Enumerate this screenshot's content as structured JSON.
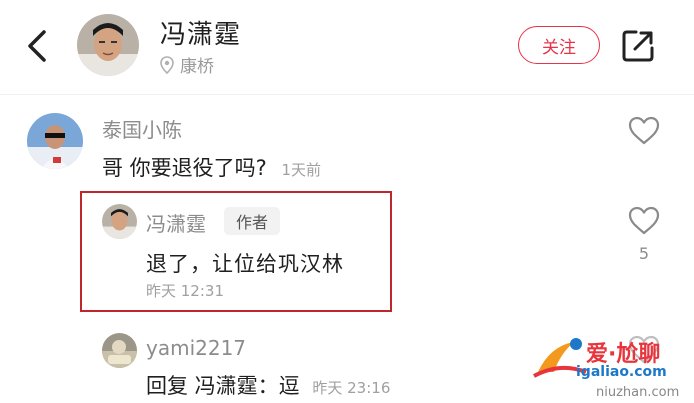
{
  "header": {
    "name": "冯潇霆",
    "location": "康桥",
    "follow_label": "关注"
  },
  "comments": [
    {
      "user": "泰国小陈",
      "text": "哥 你要退役了吗?",
      "time": "1天前"
    },
    {
      "user": "冯潇霆",
      "badge": "作者",
      "text": "退了，让位给巩汉林",
      "time": "昨天 12:31",
      "likes": "5"
    },
    {
      "user": "yami2217",
      "reply_prefix": "回复 冯潇霆：逗",
      "time": "昨天 23:16"
    }
  ],
  "watermark": {
    "brand": "爱·尬聊",
    "url": "igaliao.com",
    "url2": "niuzhan.com"
  },
  "colors": {
    "accent": "#e8334a",
    "highlight_border": "#c0262c"
  }
}
